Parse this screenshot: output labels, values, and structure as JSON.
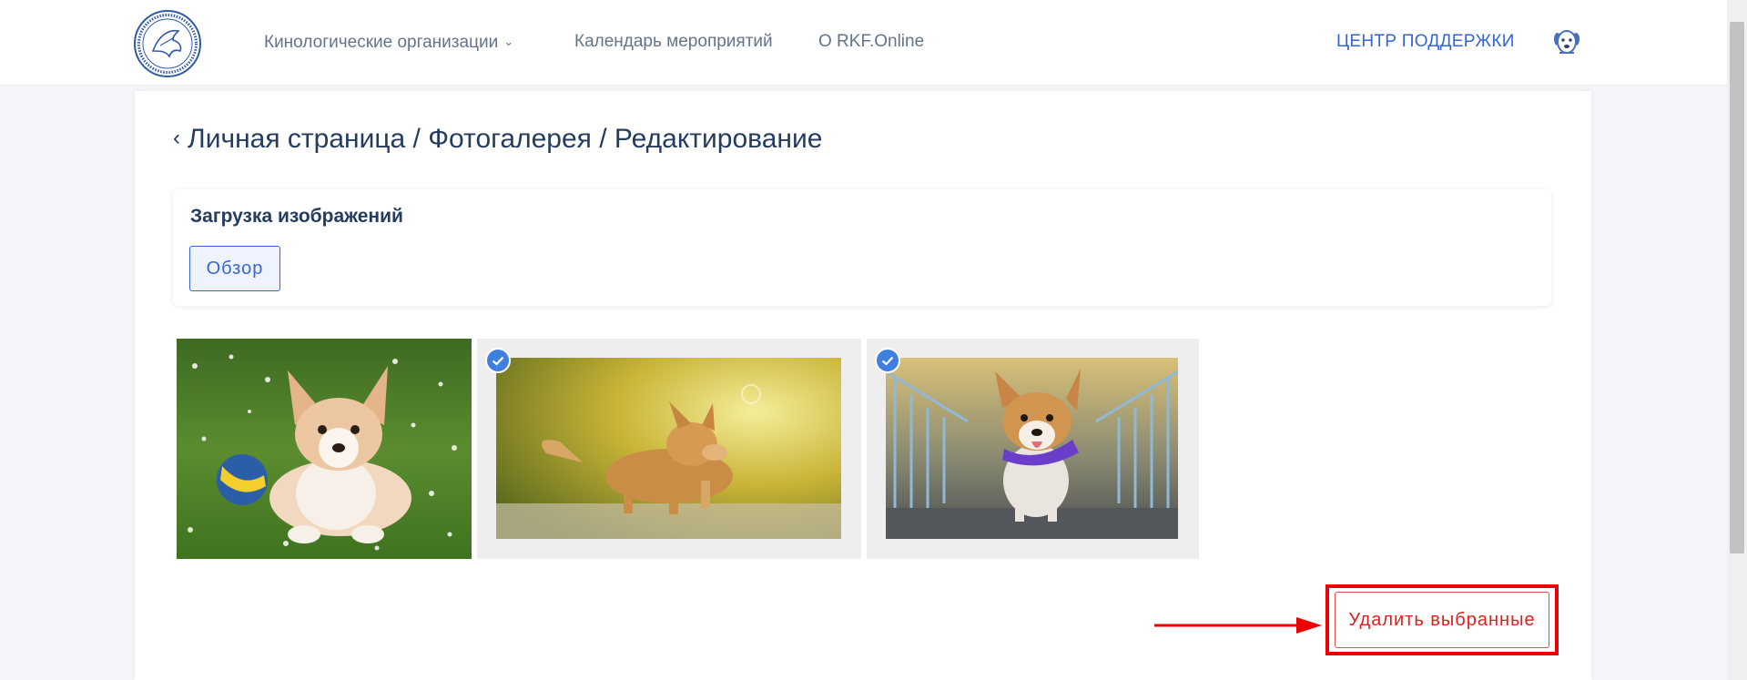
{
  "header": {
    "nav": [
      {
        "label": "Кинологические организации",
        "has_dropdown": true
      },
      {
        "label": "Календарь мероприятий",
        "has_dropdown": false
      },
      {
        "label": "О RKF.Online",
        "has_dropdown": false
      }
    ],
    "support_label": "ЦЕНТР ПОДДЕРЖКИ",
    "logo_icon": "rkf-emblem-logo",
    "avatar_icon": "dog-avatar-icon"
  },
  "page": {
    "title": "Личная страница / Фотогалерея / Редактирование",
    "back_icon": "chevron-left-icon"
  },
  "upload": {
    "title": "Загрузка изображений",
    "browse_label": "Обзор"
  },
  "gallery": {
    "photos": [
      {
        "subject": "corgi puppy on grass with ball",
        "selected": false
      },
      {
        "subject": "corgi walking in sunlight",
        "selected": true
      },
      {
        "subject": "corgi with purple bandana on bridge",
        "selected": true
      }
    ]
  },
  "actions": {
    "delete_label": "Удалить выбранные"
  },
  "colors": {
    "accent": "#3366d6",
    "danger": "#e01c1c",
    "highlight": "#ee0000",
    "text": "#253c5e",
    "check": "#3f7fe0"
  }
}
